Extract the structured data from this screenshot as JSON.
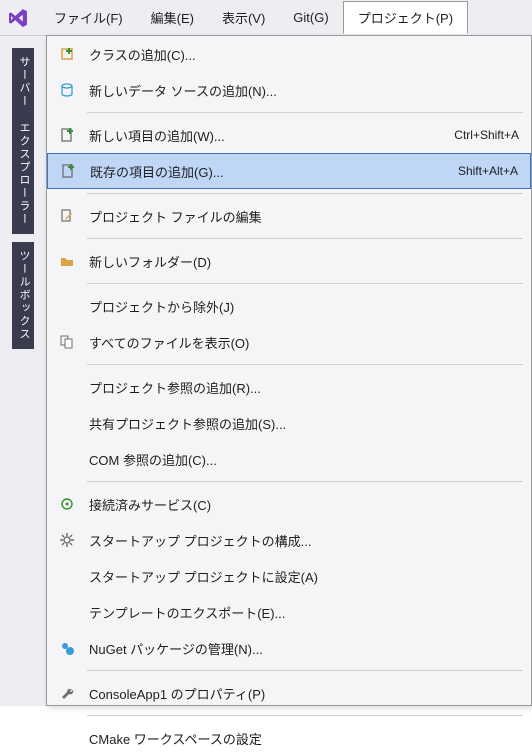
{
  "menubar": {
    "items": [
      {
        "label": "ファイル(F)"
      },
      {
        "label": "編集(E)"
      },
      {
        "label": "表示(V)"
      },
      {
        "label": "Git(G)"
      },
      {
        "label": "プロジェクト(P)"
      }
    ]
  },
  "sidebar": {
    "tabs": [
      {
        "label": "サーバー エクスプローラー"
      },
      {
        "label": "ツールボックス"
      }
    ]
  },
  "project_menu": {
    "items": [
      {
        "icon": "add-class-icon",
        "label": "クラスの追加(C)...",
        "shortcut": ""
      },
      {
        "icon": "data-source-icon",
        "label": "新しいデータ ソースの追加(N)...",
        "shortcut": ""
      },
      {
        "sep": true
      },
      {
        "icon": "new-item-icon",
        "label": "新しい項目の追加(W)...",
        "shortcut": "Ctrl+Shift+A"
      },
      {
        "icon": "existing-item-icon",
        "label": "既存の項目の追加(G)...",
        "shortcut": "Shift+Alt+A",
        "selected": true
      },
      {
        "sep": true
      },
      {
        "icon": "edit-file-icon",
        "label": "プロジェクト ファイルの編集",
        "shortcut": ""
      },
      {
        "sep": true
      },
      {
        "icon": "new-folder-icon",
        "label": "新しいフォルダー(D)",
        "shortcut": ""
      },
      {
        "sep": true
      },
      {
        "icon": "",
        "label": "プロジェクトから除外(J)",
        "shortcut": ""
      },
      {
        "icon": "show-all-icon",
        "label": "すべてのファイルを表示(O)",
        "shortcut": ""
      },
      {
        "sep": true
      },
      {
        "icon": "",
        "label": "プロジェクト参照の追加(R)...",
        "shortcut": ""
      },
      {
        "icon": "",
        "label": "共有プロジェクト参照の追加(S)...",
        "shortcut": ""
      },
      {
        "icon": "",
        "label": "COM 参照の追加(C)...",
        "shortcut": ""
      },
      {
        "sep": true
      },
      {
        "icon": "connected-service-icon",
        "label": "接続済みサービス(C)",
        "shortcut": ""
      },
      {
        "icon": "gear-icon",
        "label": "スタートアップ プロジェクトの構成...",
        "shortcut": ""
      },
      {
        "icon": "",
        "label": "スタートアップ プロジェクトに設定(A)",
        "shortcut": ""
      },
      {
        "icon": "",
        "label": "テンプレートのエクスポート(E)...",
        "shortcut": ""
      },
      {
        "icon": "nuget-icon",
        "label": "NuGet パッケージの管理(N)...",
        "shortcut": ""
      },
      {
        "sep": true
      },
      {
        "icon": "wrench-icon",
        "label": "ConsoleApp1 のプロパティ(P)",
        "shortcut": ""
      },
      {
        "sep": true
      },
      {
        "icon": "",
        "label": "CMake ワークスペースの設定",
        "shortcut": ""
      }
    ]
  },
  "icons": {
    "vs_color": "#7b3fc4"
  }
}
